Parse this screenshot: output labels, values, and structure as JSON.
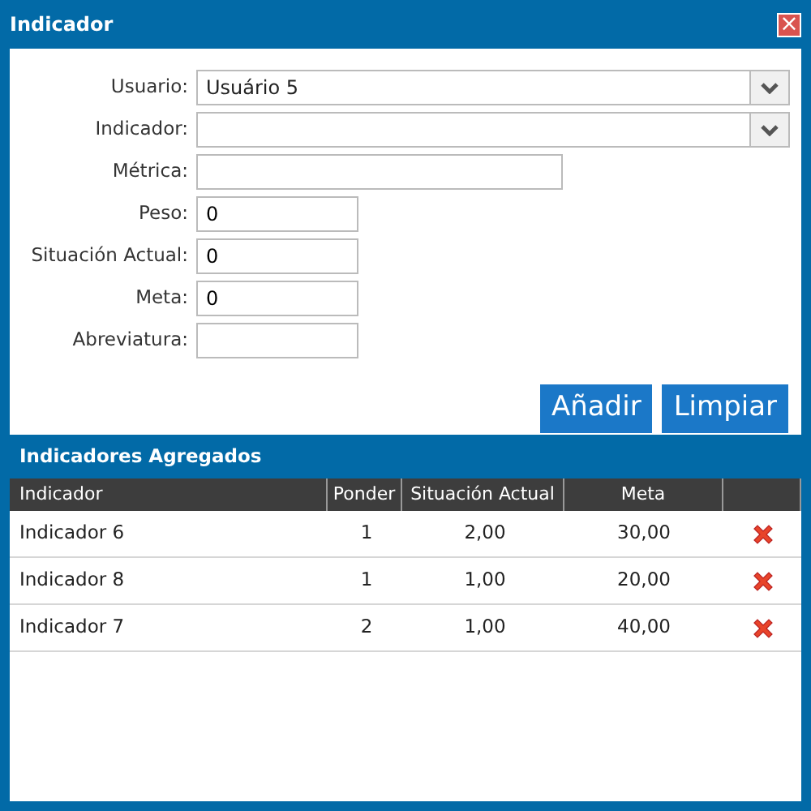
{
  "window": {
    "title": "Indicador",
    "close": "×"
  },
  "form": [
    {
      "label": "Usuario:",
      "kind": "select",
      "value": "Usuário 5"
    },
    {
      "label": "Indicador:",
      "kind": "select"
    },
    {
      "label": "Métrica:",
      "kind": "longtext"
    },
    {
      "label": "Peso:",
      "kind": "shorttext",
      "value": "0"
    },
    {
      "label": "Situación Actual:",
      "kind": "shorttext",
      "value": "0"
    },
    {
      "label": "Meta:",
      "kind": "shorttext",
      "value": "0"
    },
    {
      "label": "Abreviatura:",
      "kind": "shorttext"
    }
  ],
  "buttons": [
    "Añadir",
    "Limpiar"
  ],
  "section_title": "Indicadores Agregados",
  "table": {
    "columns": [
      "Indicador",
      "Ponder",
      "Situación Actual",
      "Meta"
    ],
    "rows": [
      {
        "cells": [
          "Indicador 6",
          "1",
          "2,00",
          "30,00"
        ]
      },
      {
        "cells": [
          "Indicador 8",
          "1",
          "1,00",
          "20,00"
        ]
      },
      {
        "cells": [
          "Indicador 7",
          "2",
          "1,00",
          "40,00"
        ]
      }
    ]
  }
}
